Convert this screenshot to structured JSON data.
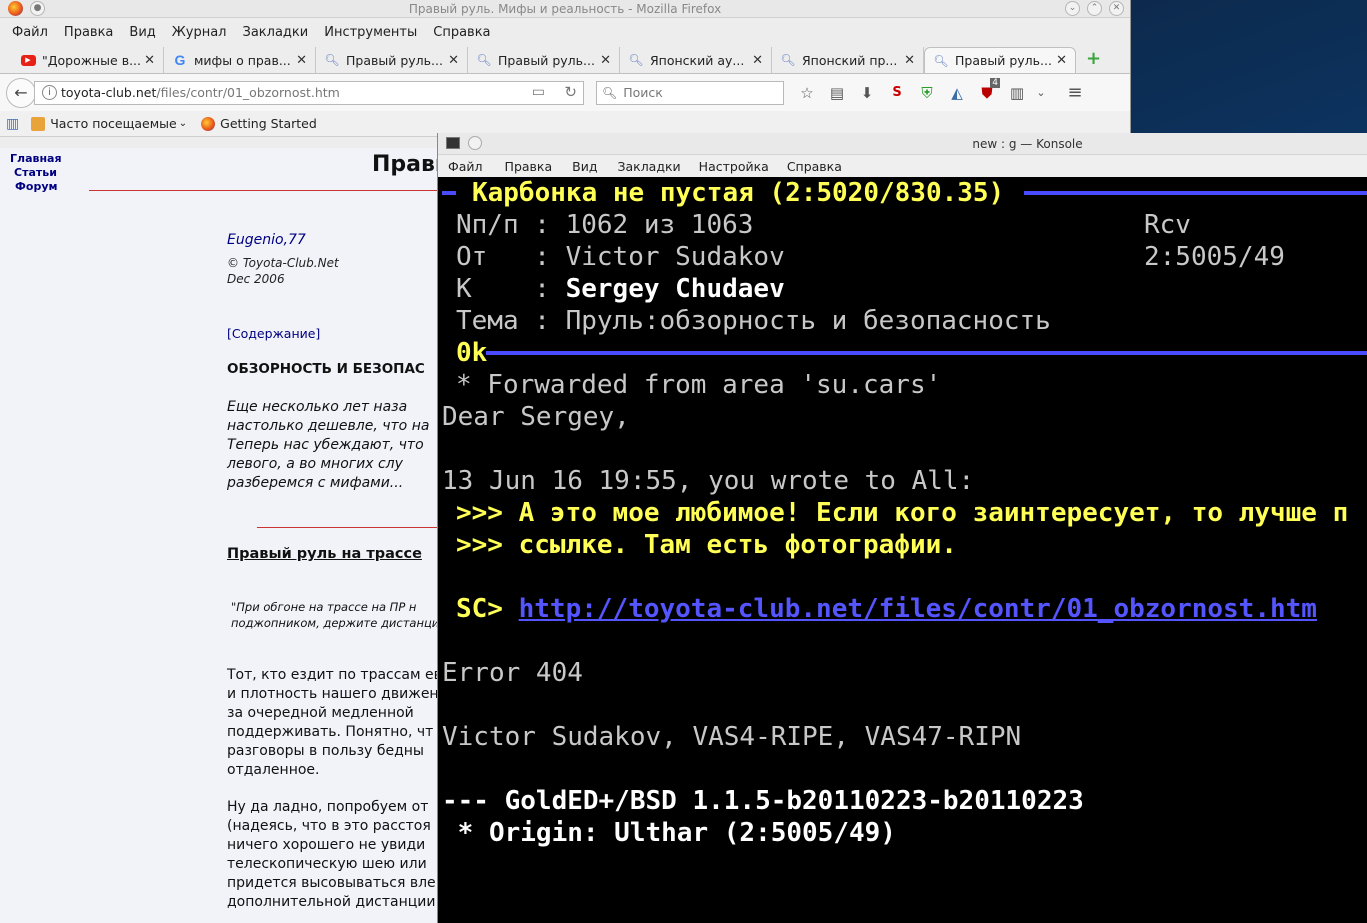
{
  "firefox": {
    "window_title": "Правый руль. Мифы и реальность - Mozilla Firefox",
    "menu": [
      "Файл",
      "Правка",
      "Вид",
      "Журнал",
      "Закладки",
      "Инструменты",
      "Справка"
    ],
    "tabs": [
      {
        "icon": "youtube-icon",
        "label": "\"Дорожные в..."
      },
      {
        "icon": "google-icon",
        "label": "мифы о прав..."
      },
      {
        "icon": "search-page-icon",
        "label": "Правый руль..."
      },
      {
        "icon": "search-page-icon",
        "label": "Правый руль..."
      },
      {
        "icon": "search-page-icon",
        "label": "Японский ау..."
      },
      {
        "icon": "search-page-icon",
        "label": "Японский пр..."
      },
      {
        "icon": "search-page-icon",
        "label": "Правый руль..."
      }
    ],
    "url_domain": "toyota-club.net",
    "url_path": "/files/contr/01_obzornost.htm",
    "search_placeholder": "Поиск",
    "badge_count": "4",
    "bookmarks": {
      "most_visited": "Часто посещаемые",
      "getting_started": "Getting Started"
    }
  },
  "page": {
    "nav": [
      "Главная",
      "Статьи",
      "Форум"
    ],
    "title": "Правы",
    "author": "Eugenio,77",
    "copyright": "© Toyota-Club.Net",
    "date": "Dec 2006",
    "toc": "[Содержание]",
    "heading": "ОБЗОРНОСТЬ И БЕЗОПАС",
    "intro": [
      "Еще несколько лет наза",
      "настолько дешевле, что на",
      "Теперь нас убеждают, что",
      "левого, а во многих слу",
      "разберемся с мифами..."
    ],
    "subheading": "Правый руль на трассе",
    "quote": [
      "\"При обгоне на трассе на ПР н",
      "поджопником, держите дистанци"
    ],
    "para1": [
      "Тот, кто ездит по трассам ев",
      "и плотность нашего движен",
      "за очередной медленной",
      "поддерживать. Понятно, чт",
      "разговоры в пользу бедны",
      "отдаленное."
    ],
    "para2": [
      "Ну да ладно, попробуем от",
      "(надеясь, что в это расстоя",
      "ничего хорошего не увиди",
      "телескопическую шею или",
      "придется высовываться вле",
      "дополнительной дистанции."
    ]
  },
  "konsole": {
    "window_title": "new : g — Konsole",
    "menu": [
      "Файл",
      "Правка",
      "Вид",
      "Закладки",
      "Настройка",
      "Справка"
    ],
    "area_title": "Карбонка не пустая (2:5020/830.35)",
    "num_label": "Nп/п : 1062 из 1063",
    "rcv": "Rcv",
    "from_label": "От   : ",
    "from_name": "Victor Sudakov",
    "from_addr": "2:5005/49",
    "to_label": "К    : ",
    "to_name": "Sergey Chudaev",
    "subject_label": "Тема : Пруль:обзорность и безопасность",
    "size": "0k",
    "forwarded": "* Forwarded from area 'su.cars'",
    "greeting": "Dear Sergey,",
    "quote_intro": "13 Jun 16 19:55, you wrote to All:",
    "q1_prefix": ">>> ",
    "q1": "А это мое любимое! Если кого заинтересует, то лучше п",
    "q2_prefix": ">>> ",
    "q2": "ссылке. Там есть фотографии.",
    "sc_prefix": "SC> ",
    "sc_link": "http://toyota-club.net/files/contr/01_obzornost.htm",
    "error": "Error 404",
    "signature": "Victor Sudakov, VAS4-RIPE, VAS47-RIPN",
    "tearline": "--- GoldED+/BSD 1.1.5-b20110223-b20110223",
    "origin": " * Origin: Ulthar (2:5005/49)"
  }
}
